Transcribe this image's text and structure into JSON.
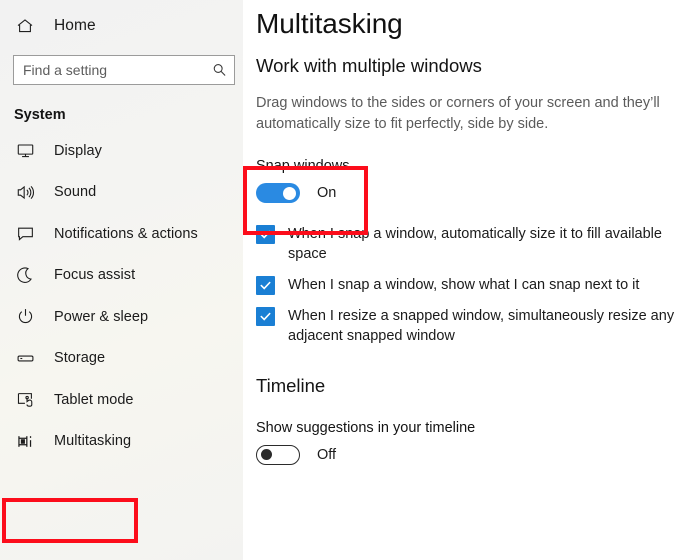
{
  "sidebar": {
    "home": {
      "label": "Home",
      "icon": "home-icon"
    },
    "search": {
      "placeholder": "Find a setting",
      "value": "",
      "icon": "search-icon"
    },
    "section_title": "System",
    "items": [
      {
        "label": "Display",
        "icon": "monitor-icon"
      },
      {
        "label": "Sound",
        "icon": "speaker-icon"
      },
      {
        "label": "Notifications & actions",
        "icon": "notification-icon"
      },
      {
        "label": "Focus assist",
        "icon": "moon-icon"
      },
      {
        "label": "Power & sleep",
        "icon": "power-icon"
      },
      {
        "label": "Storage",
        "icon": "drive-icon"
      },
      {
        "label": "Tablet mode",
        "icon": "tablet-icon"
      },
      {
        "label": "Multitasking",
        "icon": "multitasking-icon"
      }
    ]
  },
  "main": {
    "page_title": "Multitasking",
    "group_heading": "Work with multiple windows",
    "description": "Drag windows to the sides or corners of your screen and they’ll automatically size to fit perfectly, side by side.",
    "snap": {
      "label": "Snap windows",
      "state": "On",
      "checked": true
    },
    "checkboxes": [
      {
        "label": "When I snap a window, automatically size it to fill available space",
        "checked": true
      },
      {
        "label": "When I snap a window, show what I can snap next to it",
        "checked": true
      },
      {
        "label": "When I resize a snapped window, simultaneously resize any adjacent snapped window",
        "checked": true
      }
    ],
    "timeline": {
      "heading": "Timeline",
      "label": "Show suggestions in your timeline",
      "state": "Off",
      "checked": false
    }
  },
  "colors": {
    "accent_blue": "#2a8ae2",
    "checkbox_blue": "#1a7fd4",
    "highlight_red": "#fc0d1b",
    "sidebar_bg": "#f4f4f2",
    "text_primary": "#1b1b1b",
    "text_secondary": "#5b5b5b"
  }
}
